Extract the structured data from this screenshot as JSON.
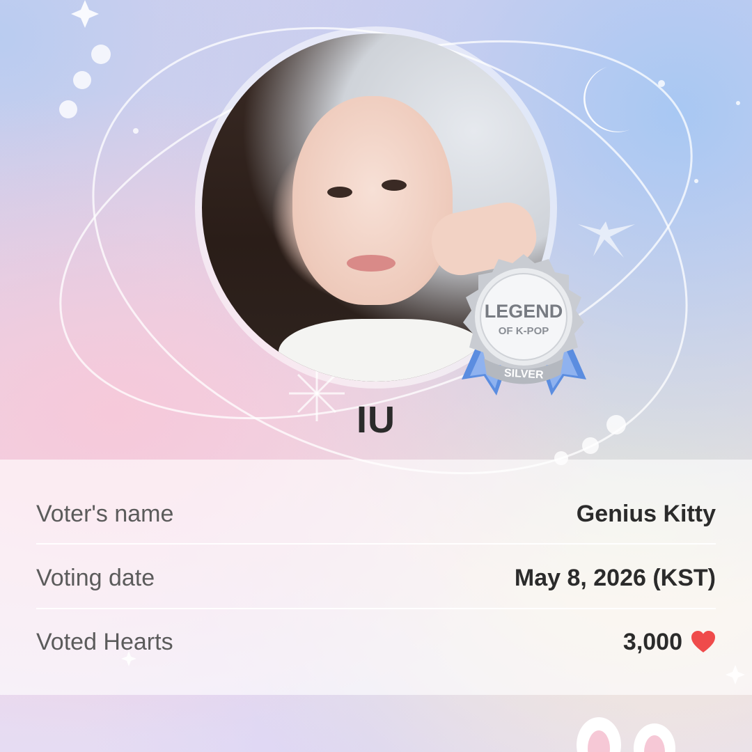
{
  "artist": {
    "name": "IU",
    "badge": {
      "title": "LEGEND",
      "subtitle": "OF K-POP",
      "tier": "SILVER"
    }
  },
  "vote_info": {
    "rows": [
      {
        "label": "Voter's name",
        "value": "Genius Kitty"
      },
      {
        "label": "Voting date",
        "value": "May 8, 2026 (KST)"
      },
      {
        "label": "Voted Hearts",
        "value": "3,000",
        "icon": "heart-icon"
      }
    ]
  },
  "colors": {
    "heart": "#ef4b4b",
    "badge_ribbon": "#5b8de0",
    "badge_silver": "#c9ccd2"
  }
}
